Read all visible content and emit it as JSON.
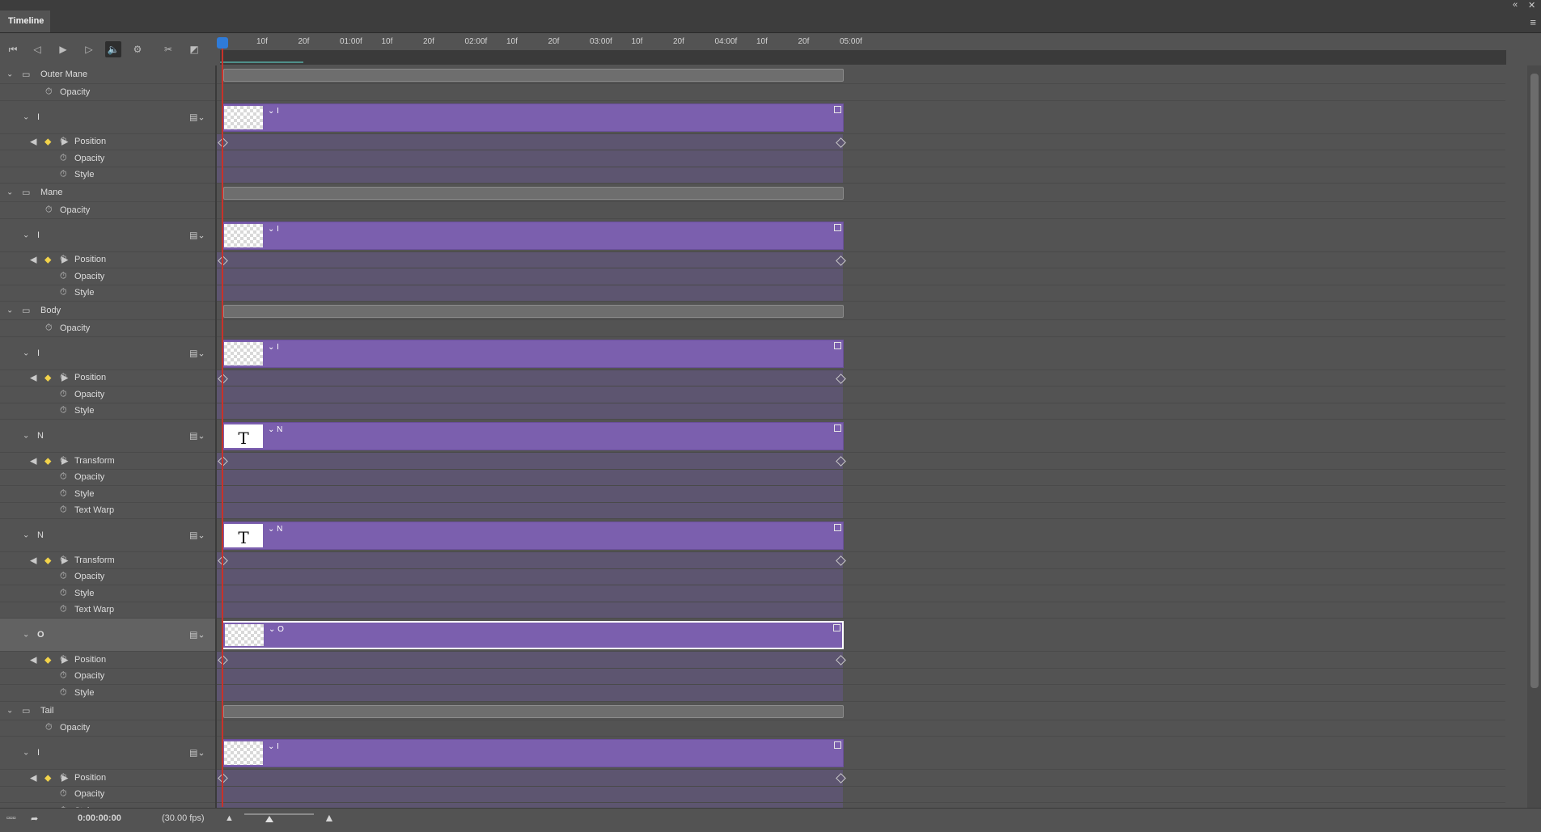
{
  "panel": {
    "tab_label": "Timeline",
    "menu_icon": "menu-icon"
  },
  "toolbar": {
    "buttons": [
      "go-to-first-frame",
      "go-to-previous-frame",
      "play",
      "go-to-next-frame",
      "mute-audio",
      "settings",
      "split-at-playhead",
      "transition"
    ]
  },
  "ruler": {
    "labels": [
      "10f",
      "20f",
      "01:00f",
      "10f",
      "20f",
      "02:00f",
      "10f",
      "20f",
      "03:00f",
      "10f",
      "20f",
      "04:00f",
      "10f",
      "20f",
      "05:00f"
    ]
  },
  "layers": [
    {
      "kind": "group",
      "label": "Outer Mane"
    },
    {
      "kind": "prop",
      "label": "Opacity",
      "indent": 1
    },
    {
      "kind": "layer",
      "label": "I",
      "clip": "I",
      "thumb": "checker"
    },
    {
      "kind": "prop",
      "label": "Position",
      "keys": true
    },
    {
      "kind": "prop",
      "label": "Opacity"
    },
    {
      "kind": "prop",
      "label": "Style"
    },
    {
      "kind": "group",
      "label": "Mane"
    },
    {
      "kind": "prop",
      "label": "Opacity",
      "indent": 1
    },
    {
      "kind": "layer",
      "label": "I",
      "clip": "I",
      "thumb": "checker"
    },
    {
      "kind": "prop",
      "label": "Position",
      "keys": true
    },
    {
      "kind": "prop",
      "label": "Opacity"
    },
    {
      "kind": "prop",
      "label": "Style"
    },
    {
      "kind": "group",
      "label": "Body"
    },
    {
      "kind": "prop",
      "label": "Opacity",
      "indent": 1
    },
    {
      "kind": "layer",
      "label": "I",
      "clip": "I",
      "thumb": "checker"
    },
    {
      "kind": "prop",
      "label": "Position",
      "keys": true
    },
    {
      "kind": "prop",
      "label": "Opacity"
    },
    {
      "kind": "prop",
      "label": "Style"
    },
    {
      "kind": "layer",
      "label": "N",
      "clip": "N",
      "thumb": "T"
    },
    {
      "kind": "prop",
      "label": "Transform",
      "keys": true
    },
    {
      "kind": "prop",
      "label": "Opacity"
    },
    {
      "kind": "prop",
      "label": "Style"
    },
    {
      "kind": "prop",
      "label": "Text Warp"
    },
    {
      "kind": "layer",
      "label": "N",
      "clip": "N",
      "thumb": "T"
    },
    {
      "kind": "prop",
      "label": "Transform",
      "keys": true
    },
    {
      "kind": "prop",
      "label": "Opacity"
    },
    {
      "kind": "prop",
      "label": "Style"
    },
    {
      "kind": "prop",
      "label": "Text Warp"
    },
    {
      "kind": "layer",
      "label": "O",
      "clip": "O",
      "thumb": "checker",
      "selected": true
    },
    {
      "kind": "prop",
      "label": "Position",
      "keys": true
    },
    {
      "kind": "prop",
      "label": "Opacity"
    },
    {
      "kind": "prop",
      "label": "Style"
    },
    {
      "kind": "group",
      "label": "Tail"
    },
    {
      "kind": "prop",
      "label": "Opacity",
      "indent": 1
    },
    {
      "kind": "layer",
      "label": "I",
      "clip": "I",
      "thumb": "checker"
    },
    {
      "kind": "prop",
      "label": "Position",
      "keys": true
    },
    {
      "kind": "prop",
      "label": "Opacity"
    },
    {
      "kind": "prop",
      "label": "Style"
    }
  ],
  "footer": {
    "timecode": "0:00:00:00",
    "fps": "(30.00 fps)"
  }
}
